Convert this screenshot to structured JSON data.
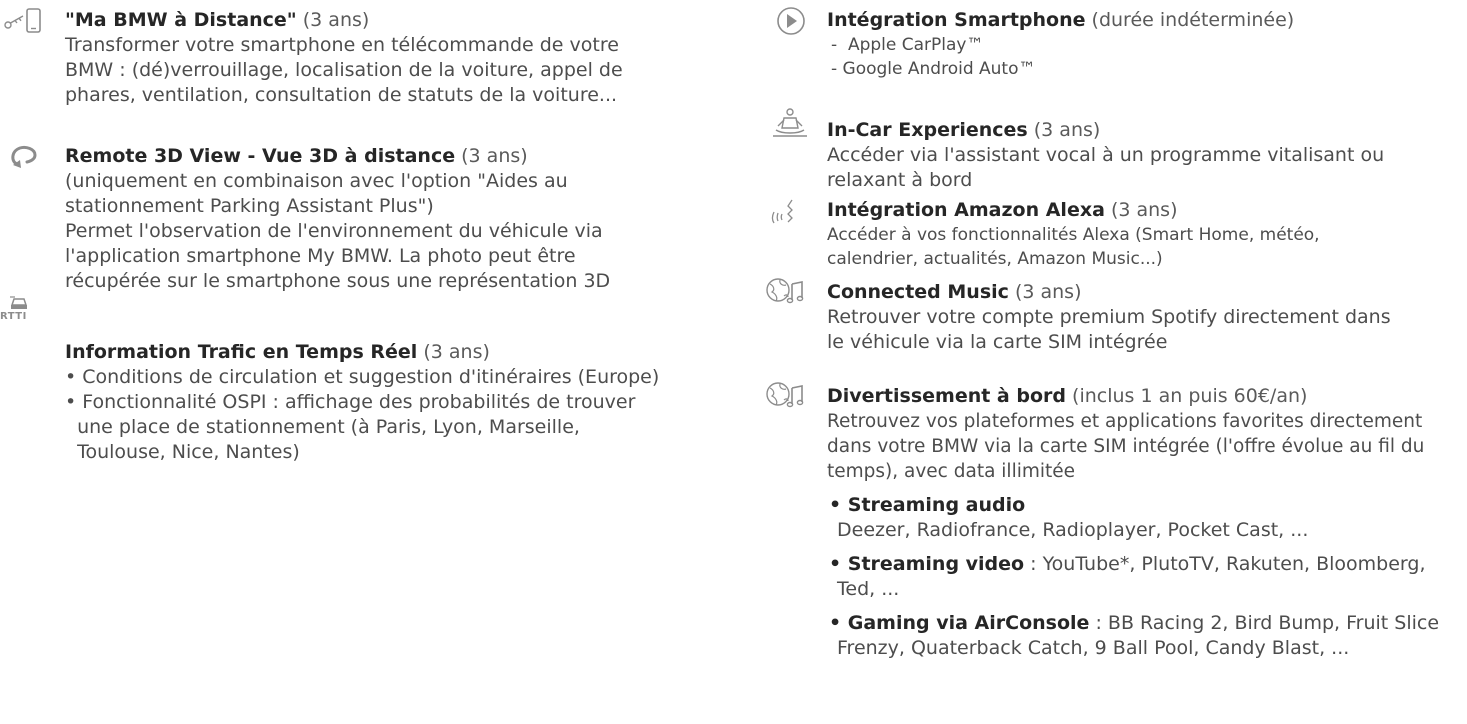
{
  "left": {
    "remote": {
      "title": "\"Ma BMW à Distance\"",
      "duration": "(3 ans)",
      "lines": [
        "Transformer votre smartphone en télécommande de votre",
        "BMW : (dé)verrouillage, localisation de la voiture, appel de",
        "phares, ventilation, consultation de statuts de la voiture..."
      ],
      "icon": "smartphone-key-icon"
    },
    "view3d": {
      "title": "Remote 3D View - Vue 3D à distance",
      "duration": "(3 ans)",
      "lines": [
        "(uniquement en combinaison avec l'option \"Aides au",
        "stationnement Parking Assistant Plus\")",
        "Permet l'observation de l'environnement du véhicule via",
        "l'application smartphone  My BMW. La photo peut être",
        "récupérée sur le smartphone sous une représentation 3D"
      ],
      "icon": "rotate-arrow-icon"
    },
    "traffic": {
      "icon_label": "RTTI",
      "title": "Information Trafic en Temps Réel",
      "duration": "(3 ans)",
      "bullets": [
        [
          "• Conditions de circulation et suggestion d'itinéraires (Europe)"
        ],
        [
          "• Fonctionnalité OSPI : affichage des probabilités de trouver",
          "  une place de stationnement (à Paris, Lyon, Marseille,",
          "  Toulouse, Nice, Nantes)"
        ]
      ],
      "icon": "traffic-car-icon"
    }
  },
  "right": {
    "smartphone": {
      "title": "Intégration Smartphone",
      "duration": "(durée indéterminée)",
      "sublines": [
        "-  Apple CarPlay™",
        "- Google Android Auto™"
      ],
      "icon": "play-circle-icon"
    },
    "incar": {
      "title": "In-Car Experiences",
      "duration": "(3 ans)",
      "lines": [
        "Accéder via l'assistant vocal à un programme vitalisant ou",
        "relaxant à bord"
      ],
      "icon": "meditation-icon"
    },
    "alexa": {
      "title": "Intégration Amazon Alexa",
      "duration": "(3 ans)",
      "sublines": [
        "Accéder à vos fonctionnalités Alexa (Smart Home, météo,",
        "calendrier, actualités, Amazon Music...)"
      ],
      "icon": "voice-wave-icon"
    },
    "music": {
      "title": "Connected Music",
      "duration": "(3 ans)",
      "lines": [
        "Retrouver votre compte premium Spotify directement dans",
        "le véhicule via la carte SIM intégrée"
      ],
      "icon": "globe-music-icon"
    },
    "entertainment": {
      "title": "Divertissement à bord",
      "duration": "(inclus 1 an puis 60€/an)",
      "lines": [
        "Retrouvez vos plateformes et applications favorites directement",
        "dans votre BMW via la carte SIM intégrée (l'offre évolue au fil du",
        "temps), avec data illimitée"
      ],
      "bullets": [
        {
          "bold": "• Streaming audio",
          "rest": "",
          "cont": "Deezer, Radiofrance, Radioplayer, Pocket Cast, ..."
        },
        {
          "bold": "• Streaming video",
          "rest": " : YouTube*, PlutoTV, Rakuten, Bloomberg,",
          "cont": "Ted, ..."
        },
        {
          "bold": "• Gaming via AirConsole",
          "rest": " : BB Racing 2, Bird Bump, Fruit Slice",
          "cont": "Frenzy, Quaterback Catch, 9 Ball Pool, Candy Blast, ..."
        }
      ],
      "icon": "globe-music-icon"
    }
  }
}
